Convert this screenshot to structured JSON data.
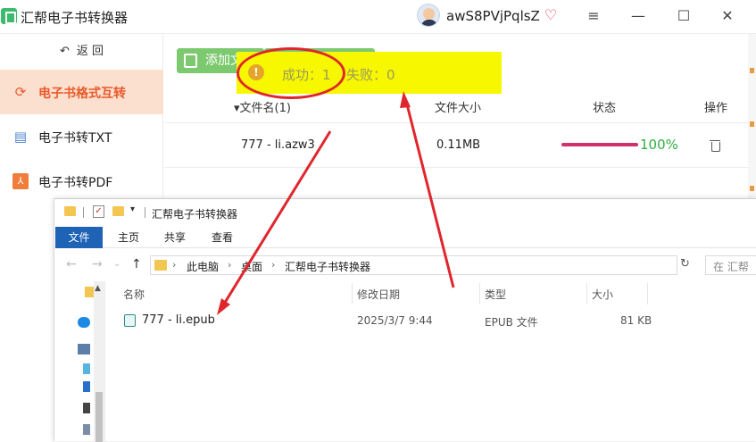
{
  "app": {
    "title": "汇帮电子书转换器",
    "user_name": "awS8PVjPqlsZ",
    "vip_icon": "heart-diamond-icon"
  },
  "window_controls": {
    "menu": "≡",
    "minimize": "—",
    "maximize": "☐",
    "close": "✕"
  },
  "sidebar": {
    "back_arrow": "↶",
    "back_label": "返  回",
    "items": [
      {
        "icon": "refresh-icon",
        "label": "电子书格式互转",
        "active": true
      },
      {
        "icon": "document-icon",
        "label": "电子书转TXT",
        "active": false
      },
      {
        "icon": "pdf-icon",
        "label": "电子书转PDF",
        "active": false
      }
    ]
  },
  "toolbar": {
    "add_label": "添加文件"
  },
  "table": {
    "headers": {
      "filename": "▾文件名(1)",
      "filesize": "文件大小",
      "status": "状态",
      "action": "操作"
    },
    "rows": [
      {
        "filename": "777 - li.azw3",
        "filesize": "0.11MB",
        "progress": 1.0,
        "progress_text": "100%"
      }
    ]
  },
  "toast": {
    "icon": "info-icon",
    "success_text": "成功：1",
    "fail_text": "失败：0",
    "bg_color": "#f7f700"
  },
  "explorer": {
    "title": "汇帮电子书转换器",
    "ribbon_tabs": [
      "文件",
      "主页",
      "共享",
      "查看"
    ],
    "address": {
      "parts": [
        "此电脑",
        "桌面",
        "汇帮电子书转换器"
      ],
      "search_placeholder": "在 汇帮"
    },
    "columns": {
      "name": "名称",
      "modified": "修改日期",
      "type": "类型",
      "size": "大小"
    },
    "files": [
      {
        "name": "777 - li.epub",
        "modified": "2025/3/7 9:44",
        "type": "EPUB 文件",
        "size": "81 KB"
      }
    ]
  },
  "colors": {
    "accent_orange": "#e95a2a",
    "active_bg": "#fbdfcf",
    "green_button": "#7dc96f",
    "progress": "#d2306a",
    "progress_text": "#2eae3f",
    "annotation_red": "#e0262d"
  }
}
